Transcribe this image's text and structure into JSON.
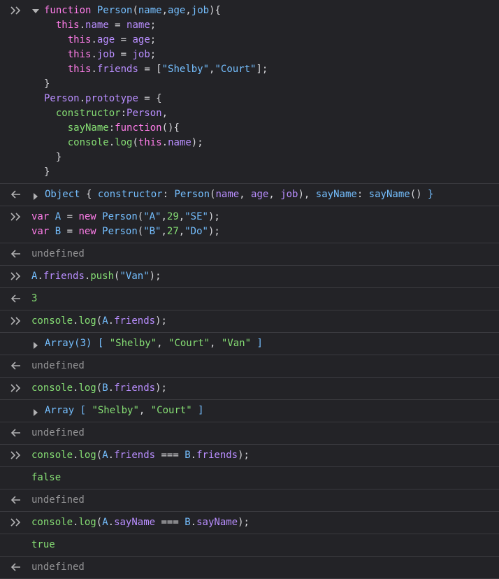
{
  "icons": {
    "input": "chevrons-right-icon",
    "output": "arrow-left-icon"
  },
  "entries": [
    {
      "type": "input",
      "lines": [
        [
          {
            "c": "kw",
            "t": "function "
          },
          {
            "c": "cn",
            "t": "Person"
          },
          {
            "c": "pl",
            "t": "("
          },
          {
            "c": "cn",
            "t": "name"
          },
          {
            "c": "pl",
            "t": ","
          },
          {
            "c": "cn",
            "t": "age"
          },
          {
            "c": "pl",
            "t": ","
          },
          {
            "c": "cn",
            "t": "job"
          },
          {
            "c": "pl",
            "t": "){"
          }
        ],
        [
          {
            "c": "pl",
            "t": "  "
          },
          {
            "c": "kw",
            "t": "this"
          },
          {
            "c": "pl",
            "t": "."
          },
          {
            "c": "nm",
            "t": "name"
          },
          {
            "c": "pl",
            "t": " = "
          },
          {
            "c": "nm",
            "t": "name"
          },
          {
            "c": "pl",
            "t": ";"
          }
        ],
        [
          {
            "c": "pl",
            "t": "    "
          },
          {
            "c": "kw",
            "t": "this"
          },
          {
            "c": "pl",
            "t": "."
          },
          {
            "c": "nm",
            "t": "age"
          },
          {
            "c": "pl",
            "t": " = "
          },
          {
            "c": "nm",
            "t": "age"
          },
          {
            "c": "pl",
            "t": ";"
          }
        ],
        [
          {
            "c": "pl",
            "t": "    "
          },
          {
            "c": "kw",
            "t": "this"
          },
          {
            "c": "pl",
            "t": "."
          },
          {
            "c": "nm",
            "t": "job"
          },
          {
            "c": "pl",
            "t": " = "
          },
          {
            "c": "nm",
            "t": "job"
          },
          {
            "c": "pl",
            "t": ";"
          }
        ],
        [
          {
            "c": "pl",
            "t": "    "
          },
          {
            "c": "kw",
            "t": "this"
          },
          {
            "c": "pl",
            "t": "."
          },
          {
            "c": "nm",
            "t": "friends"
          },
          {
            "c": "pl",
            "t": " = ["
          },
          {
            "c": "cn",
            "t": "\"Shelby\""
          },
          {
            "c": "pl",
            "t": ","
          },
          {
            "c": "cn",
            "t": "\"Court\""
          },
          {
            "c": "pl",
            "t": "];"
          }
        ],
        [
          {
            "c": "pl",
            "t": "}"
          }
        ],
        [
          {
            "c": "nm",
            "t": "Person"
          },
          {
            "c": "pl",
            "t": "."
          },
          {
            "c": "nm",
            "t": "prototype"
          },
          {
            "c": "pl",
            "t": " = {"
          }
        ],
        [
          {
            "c": "pl",
            "t": "  "
          },
          {
            "c": "st",
            "t": "constructor"
          },
          {
            "c": "pl",
            "t": ":"
          },
          {
            "c": "nm",
            "t": "Person"
          },
          {
            "c": "pl",
            "t": ","
          }
        ],
        [
          {
            "c": "pl",
            "t": "    "
          },
          {
            "c": "st",
            "t": "sayName"
          },
          {
            "c": "pl",
            "t": ":"
          },
          {
            "c": "kw",
            "t": "function"
          },
          {
            "c": "pl",
            "t": "(){"
          }
        ],
        [
          {
            "c": "pl",
            "t": "    "
          },
          {
            "c": "st",
            "t": "console"
          },
          {
            "c": "pl",
            "t": "."
          },
          {
            "c": "st",
            "t": "log"
          },
          {
            "c": "pl",
            "t": "("
          },
          {
            "c": "kw",
            "t": "this"
          },
          {
            "c": "pl",
            "t": "."
          },
          {
            "c": "nm",
            "t": "name"
          },
          {
            "c": "pl",
            "t": ");"
          }
        ],
        [
          {
            "c": "pl",
            "t": "  }"
          }
        ],
        [
          {
            "c": "pl",
            "t": "}"
          }
        ]
      ]
    },
    {
      "type": "output",
      "expand": true,
      "lines": [
        [
          {
            "c": "cn",
            "t": "Object"
          },
          {
            "c": "pl",
            "t": " { "
          },
          {
            "c": "cn",
            "t": "constructor"
          },
          {
            "c": "pl",
            "t": ": "
          },
          {
            "c": "cn",
            "t": "Person"
          },
          {
            "c": "pl",
            "t": "("
          },
          {
            "c": "nm",
            "t": "name"
          },
          {
            "c": "pl",
            "t": ", "
          },
          {
            "c": "nm",
            "t": "age"
          },
          {
            "c": "pl",
            "t": ", "
          },
          {
            "c": "nm",
            "t": "job"
          },
          {
            "c": "pl",
            "t": "), "
          },
          {
            "c": "cn",
            "t": "sayName"
          },
          {
            "c": "pl",
            "t": ": "
          },
          {
            "c": "cn",
            "t": "sayName"
          },
          {
            "c": "pl",
            "t": "() "
          },
          {
            "c": "cn",
            "t": "}"
          }
        ]
      ]
    },
    {
      "type": "input",
      "lines": [
        [
          {
            "c": "kw",
            "t": "var "
          },
          {
            "c": "cn",
            "t": "A"
          },
          {
            "c": "pl",
            "t": " = "
          },
          {
            "c": "kw",
            "t": "new "
          },
          {
            "c": "cn",
            "t": "Person"
          },
          {
            "c": "pl",
            "t": "("
          },
          {
            "c": "cn",
            "t": "\"A\""
          },
          {
            "c": "pl",
            "t": ","
          },
          {
            "c": "st",
            "t": "29"
          },
          {
            "c": "pl",
            "t": ","
          },
          {
            "c": "cn",
            "t": "\"SE\""
          },
          {
            "c": "pl",
            "t": ");"
          }
        ],
        [
          {
            "c": "kw",
            "t": "var "
          },
          {
            "c": "cn",
            "t": "B"
          },
          {
            "c": "pl",
            "t": " = "
          },
          {
            "c": "kw",
            "t": "new "
          },
          {
            "c": "cn",
            "t": "Person"
          },
          {
            "c": "pl",
            "t": "("
          },
          {
            "c": "cn",
            "t": "\"B\""
          },
          {
            "c": "pl",
            "t": ","
          },
          {
            "c": "st",
            "t": "27"
          },
          {
            "c": "pl",
            "t": ","
          },
          {
            "c": "cn",
            "t": "\"Do\""
          },
          {
            "c": "pl",
            "t": ");"
          }
        ]
      ]
    },
    {
      "type": "output",
      "lines": [
        [
          {
            "c": "gr",
            "t": "undefined"
          }
        ]
      ]
    },
    {
      "type": "input",
      "lines": [
        [
          {
            "c": "cn",
            "t": "A"
          },
          {
            "c": "pl",
            "t": "."
          },
          {
            "c": "nm",
            "t": "friends"
          },
          {
            "c": "pl",
            "t": "."
          },
          {
            "c": "st",
            "t": "push"
          },
          {
            "c": "pl",
            "t": "("
          },
          {
            "c": "cn",
            "t": "\"Van\""
          },
          {
            "c": "pl",
            "t": ");"
          }
        ]
      ]
    },
    {
      "type": "output",
      "lines": [
        [
          {
            "c": "st",
            "t": "3"
          }
        ]
      ]
    },
    {
      "type": "input",
      "lines": [
        [
          {
            "c": "st",
            "t": "console"
          },
          {
            "c": "pl",
            "t": "."
          },
          {
            "c": "st",
            "t": "log"
          },
          {
            "c": "pl",
            "t": "("
          },
          {
            "c": "cn",
            "t": "A"
          },
          {
            "c": "pl",
            "t": "."
          },
          {
            "c": "nm",
            "t": "friends"
          },
          {
            "c": "pl",
            "t": ");"
          }
        ]
      ]
    },
    {
      "type": "log",
      "expand": true,
      "lines": [
        [
          {
            "c": "cn",
            "t": "Array(3) "
          },
          {
            "c": "cn",
            "t": "[ "
          },
          {
            "c": "st",
            "t": "\"Shelby\""
          },
          {
            "c": "pl",
            "t": ", "
          },
          {
            "c": "st",
            "t": "\"Court\""
          },
          {
            "c": "pl",
            "t": ", "
          },
          {
            "c": "st",
            "t": "\"Van\""
          },
          {
            "c": "cn",
            "t": " ]"
          }
        ]
      ]
    },
    {
      "type": "output",
      "lines": [
        [
          {
            "c": "gr",
            "t": "undefined"
          }
        ]
      ]
    },
    {
      "type": "input",
      "lines": [
        [
          {
            "c": "st",
            "t": "console"
          },
          {
            "c": "pl",
            "t": "."
          },
          {
            "c": "st",
            "t": "log"
          },
          {
            "c": "pl",
            "t": "("
          },
          {
            "c": "cn",
            "t": "B"
          },
          {
            "c": "pl",
            "t": "."
          },
          {
            "c": "nm",
            "t": "friends"
          },
          {
            "c": "pl",
            "t": ");"
          }
        ]
      ]
    },
    {
      "type": "log",
      "expand": true,
      "lines": [
        [
          {
            "c": "cn",
            "t": "Array "
          },
          {
            "c": "cn",
            "t": "[ "
          },
          {
            "c": "st",
            "t": "\"Shelby\""
          },
          {
            "c": "pl",
            "t": ", "
          },
          {
            "c": "st",
            "t": "\"Court\""
          },
          {
            "c": "cn",
            "t": " ]"
          }
        ]
      ]
    },
    {
      "type": "output",
      "lines": [
        [
          {
            "c": "gr",
            "t": "undefined"
          }
        ]
      ]
    },
    {
      "type": "input",
      "lines": [
        [
          {
            "c": "st",
            "t": "console"
          },
          {
            "c": "pl",
            "t": "."
          },
          {
            "c": "st",
            "t": "log"
          },
          {
            "c": "pl",
            "t": "("
          },
          {
            "c": "cn",
            "t": "A"
          },
          {
            "c": "pl",
            "t": "."
          },
          {
            "c": "nm",
            "t": "friends"
          },
          {
            "c": "pl",
            "t": " === "
          },
          {
            "c": "cn",
            "t": "B"
          },
          {
            "c": "pl",
            "t": "."
          },
          {
            "c": "nm",
            "t": "friends"
          },
          {
            "c": "pl",
            "t": ");"
          }
        ]
      ]
    },
    {
      "type": "log",
      "lines": [
        [
          {
            "c": "st",
            "t": "false"
          }
        ]
      ]
    },
    {
      "type": "output",
      "lines": [
        [
          {
            "c": "gr",
            "t": "undefined"
          }
        ]
      ]
    },
    {
      "type": "input",
      "lines": [
        [
          {
            "c": "st",
            "t": "console"
          },
          {
            "c": "pl",
            "t": "."
          },
          {
            "c": "st",
            "t": "log"
          },
          {
            "c": "pl",
            "t": "("
          },
          {
            "c": "cn",
            "t": "A"
          },
          {
            "c": "pl",
            "t": "."
          },
          {
            "c": "nm",
            "t": "sayName"
          },
          {
            "c": "pl",
            "t": " === "
          },
          {
            "c": "cn",
            "t": "B"
          },
          {
            "c": "pl",
            "t": "."
          },
          {
            "c": "nm",
            "t": "sayName"
          },
          {
            "c": "pl",
            "t": ");"
          }
        ]
      ]
    },
    {
      "type": "log",
      "lines": [
        [
          {
            "c": "st",
            "t": "true"
          }
        ]
      ]
    },
    {
      "type": "output",
      "lines": [
        [
          {
            "c": "gr",
            "t": "undefined"
          }
        ]
      ]
    }
  ]
}
